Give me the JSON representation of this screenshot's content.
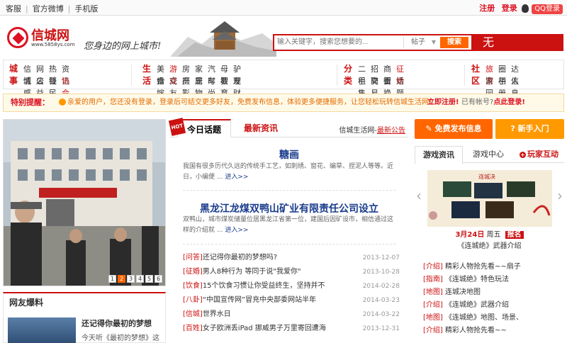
{
  "topbar": {
    "links": [
      "客服",
      "官方微博",
      "手机版"
    ],
    "register": "注册",
    "login": "登录",
    "qq_login": "QQ登录"
  },
  "header": {
    "logo_name": "信城网",
    "logo_url": "www.5858ys.com",
    "slogan": "您身边的网上城市!",
    "search_placeholder": "输入关键字，搜索您想要的...",
    "search_scope": "帖子",
    "search_button": "搜索",
    "ad_text": "无"
  },
  "nav": [
    {
      "cat": "城事",
      "items": [
        "信城",
        "网店",
        "热线",
        "资讯",
        "情感",
        "公益",
        "警民",
        "协会"
      ],
      "highlight": [
        "协会"
      ]
    },
    {
      "cat": "生活",
      "items": [
        "美食",
        "游戏",
        "房产",
        "家居",
        "汽车",
        "母婴",
        "驴友",
        "婚嫁",
        "交友",
        "摄影",
        "宠物",
        "时尚",
        "教育",
        "理财"
      ],
      "highlight": [
        "游戏"
      ]
    },
    {
      "cat": "分类",
      "items": [
        "二手",
        "招聘",
        "商街",
        "征婚",
        "租售",
        "交易",
        "置换",
        "话题"
      ],
      "highlight": [
        "征婚"
      ]
    },
    {
      "cat": "社区",
      "items": [
        "旅游",
        "圈子",
        "达人",
        "家园",
        "相册",
        "信息"
      ],
      "highlight": []
    }
  ],
  "notice": {
    "label": "特别提醒：",
    "message": "亲爱的用户，您还没有登录，登录后可结交更多好友，免费发布信息，体验更多便捷服务，让您轻松玩转信城生活网!",
    "register_now": "立即注册",
    "have_account": "已有帐号?",
    "login_now": "点此登录"
  },
  "slider": {
    "pages": [
      "1",
      "2",
      "3",
      "4",
      "5",
      "6"
    ],
    "active": "2"
  },
  "photo_section": {
    "title": "网友爆料",
    "item_title": "还记得你最初的梦想",
    "item_text": "今天听《最初的梦想》这"
  },
  "middle": {
    "hot_label": "HOT",
    "tab1": "今日话题",
    "tab2": "最新资讯",
    "more_prefix": "信城生活网-",
    "more_link": "最新公告",
    "story1": {
      "title": "糖画",
      "summary": "我国有很多历代久远的传统手工艺，如刺绣、窗花、编草、捏泥人等等。近日，小编便 ...",
      "more": "进入>>"
    },
    "story2": {
      "title": "黑龙江龙煤双鸭山矿业有限责任公司设立",
      "summary": "双鸭山，城市煤炭储量位居黑龙江省第一位，建国后因矿设市，相信通过这样的介绍就 ...",
      "more": "进入>>"
    },
    "list": [
      {
        "tag": "[问答]",
        "text": "还记得你最初的梦想吗?",
        "date": "2013-12-07"
      },
      {
        "tag": "[征婚]",
        "text": "男人8种行为 等同于说\"我爱你\"",
        "date": "2013-10-28"
      },
      {
        "tag": "[饮食]",
        "text": "15个饮食习惯让你受益终生，坚持并不",
        "date": "2014-02-28"
      },
      {
        "tag": "[八卦]",
        "text": "“中国宣传网”冒充中央部委网站半年",
        "date": "2014-03-23"
      },
      {
        "tag": "[信城]",
        "text": "世界水日",
        "date": "2014-03-22"
      },
      {
        "tag": "[百姓]",
        "text": "女子欧洲丢iPad 挪威男子万里寄回遭海",
        "date": "2013-12-31"
      }
    ]
  },
  "right": {
    "btn_publish": "免费发布信息",
    "btn_newbie": "新手入门",
    "tab1": "游戏资讯",
    "tab2": "游戏中心",
    "tab3": "玩家互动",
    "game_title": "连城决",
    "caption_date": "3月24日",
    "caption_mid": "周五",
    "caption_badge": "报名",
    "caption2": "《连城绝》武器介绍",
    "list": [
      {
        "tag": "[介绍]",
        "text": "精彩人物抢先看~~扇子"
      },
      {
        "tag": "[指南]",
        "text": "《连城绝》特色玩法"
      },
      {
        "tag": "[地图]",
        "text": "连城决地图"
      },
      {
        "tag": "[介绍]",
        "text": "《连城绝》武器介绍"
      },
      {
        "tag": "[地图]",
        "text": "《连城绝》地图、场景、"
      },
      {
        "tag": "[介绍]",
        "text": "精彩人物抢先看~~"
      }
    ]
  }
}
